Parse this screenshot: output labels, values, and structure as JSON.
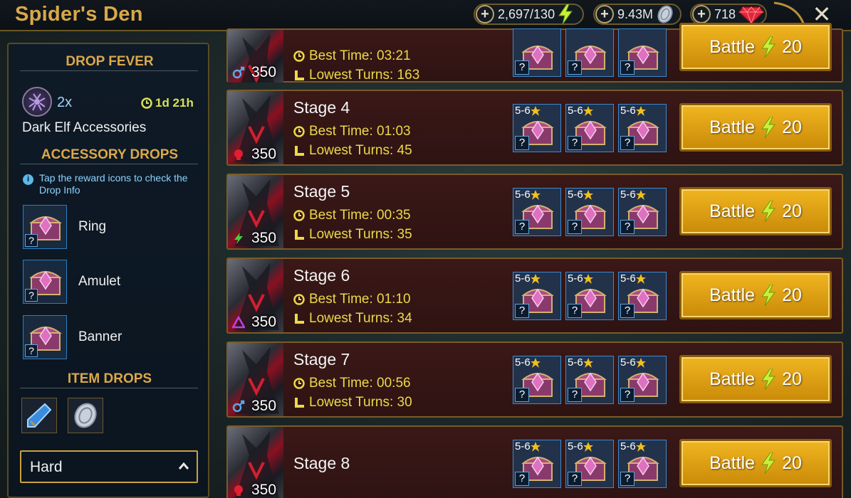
{
  "header": {
    "title": "Spider's Den",
    "energy": "2,697/130",
    "silver": "9.43M",
    "gems": "718"
  },
  "left_panel": {
    "drop_fever_heading": "DROP FEVER",
    "multiplier": "2x",
    "timer": "1d 21h",
    "fever_name": "Dark Elf Accessories",
    "accessory_drops_heading": "ACCESSORY DROPS",
    "info_text": "Tap the reward icons to check the Drop Info",
    "accessories": [
      {
        "label": "Ring"
      },
      {
        "label": "Amulet"
      },
      {
        "label": "Banner"
      }
    ],
    "item_drops_heading": "ITEM DROPS",
    "difficulty": "Hard"
  },
  "stages": [
    {
      "name": "",
      "best_time": "Best Time: 03:21",
      "lowest_turns": "Lowest Turns: 163",
      "power": "350",
      "affinity": "void",
      "battle_label": "Battle",
      "energy_cost": "20",
      "reward_stars": ""
    },
    {
      "name": "Stage 4",
      "best_time": "Best Time: 01:03",
      "lowest_turns": "Lowest Turns: 45",
      "power": "350",
      "affinity": "force",
      "battle_label": "Battle",
      "energy_cost": "20",
      "reward_stars": "5-6"
    },
    {
      "name": "Stage 5",
      "best_time": "Best Time: 00:35",
      "lowest_turns": "Lowest Turns: 35",
      "power": "350",
      "affinity": "spirit",
      "battle_label": "Battle",
      "energy_cost": "20",
      "reward_stars": "5-6"
    },
    {
      "name": "Stage 6",
      "best_time": "Best Time: 01:10",
      "lowest_turns": "Lowest Turns: 34",
      "power": "350",
      "affinity": "magic",
      "battle_label": "Battle",
      "energy_cost": "20",
      "reward_stars": "5-6"
    },
    {
      "name": "Stage 7",
      "best_time": "Best Time: 00:56",
      "lowest_turns": "Lowest Turns: 30",
      "power": "350",
      "affinity": "void",
      "battle_label": "Battle",
      "energy_cost": "20",
      "reward_stars": "5-6"
    },
    {
      "name": "Stage 8",
      "best_time": "",
      "lowest_turns": "",
      "power": "350",
      "affinity": "force",
      "battle_label": "Battle",
      "energy_cost": "20",
      "reward_stars": "5-6"
    }
  ],
  "colors": {
    "gold_heading": "#dca84a",
    "stat_yellow": "#ecd94a",
    "battle_button": "#f0b520",
    "panel_bg": "#0e1a26",
    "stage_bg": "#3a1817"
  },
  "icons": {
    "energy": "lightning-bolt-icon",
    "silver": "silver-coin-icon",
    "gems": "ruby-gem-icon",
    "clock": "clock-icon",
    "turns": "boot-icon",
    "reward": "accessory-chest-icon"
  }
}
